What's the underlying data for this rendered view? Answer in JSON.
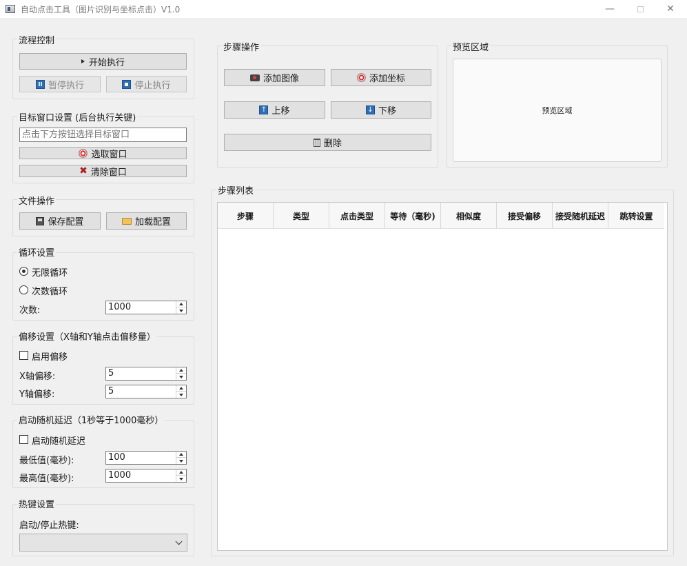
{
  "window": {
    "title": "自动点击工具（图片识别与坐标点击）V1.0",
    "min_glyph": "—",
    "close_glyph": "✕"
  },
  "flow": {
    "title": "流程控制",
    "start_label": "开始执行",
    "pause_label": "暂停执行",
    "stop_label": "停止执行"
  },
  "target": {
    "title": "目标窗口设置 (后台执行关键)",
    "placeholder": "点击下方按钮选择目标窗口",
    "select_label": "选取窗口",
    "clear_label": "清除窗口",
    "clear_glyph": "✖"
  },
  "file": {
    "title": "文件操作",
    "save_label": "保存配置",
    "load_label": "加载配置"
  },
  "loop": {
    "title": "循环设置",
    "infinite_label": "无限循环",
    "count_label": "次数循环",
    "times_label": "次数:",
    "times_value": "1000",
    "infinite_checked": true
  },
  "offset": {
    "title": "偏移设置（X轴和Y轴点击偏移量）",
    "enable_label": "启用偏移",
    "x_label": "X轴偏移:",
    "x_value": "5",
    "y_label": "Y轴偏移:",
    "y_value": "5"
  },
  "delay": {
    "title": "启动随机延迟（1秒等于1000毫秒）",
    "enable_label": "启动随机延迟",
    "min_label": "最低值(毫秒):",
    "min_value": "100",
    "max_label": "最高值(毫秒):",
    "max_value": "1000"
  },
  "hotkey": {
    "title": "热键设置",
    "label": "启动/停止热键:",
    "value": ""
  },
  "steps_ops": {
    "title": "步骤操作",
    "add_image_label": "添加图像",
    "add_coord_label": "添加坐标",
    "move_up_label": "上移",
    "move_down_label": "下移",
    "delete_label": "删除"
  },
  "preview": {
    "title": "预览区域",
    "placeholder_text": "预览区域"
  },
  "step_list": {
    "title": "步骤列表",
    "columns": [
      "步骤",
      "类型",
      "点击类型",
      "等待（毫秒)",
      "相似度",
      "接受偏移",
      "接受随机延迟",
      "跳转设置"
    ],
    "rows": []
  }
}
